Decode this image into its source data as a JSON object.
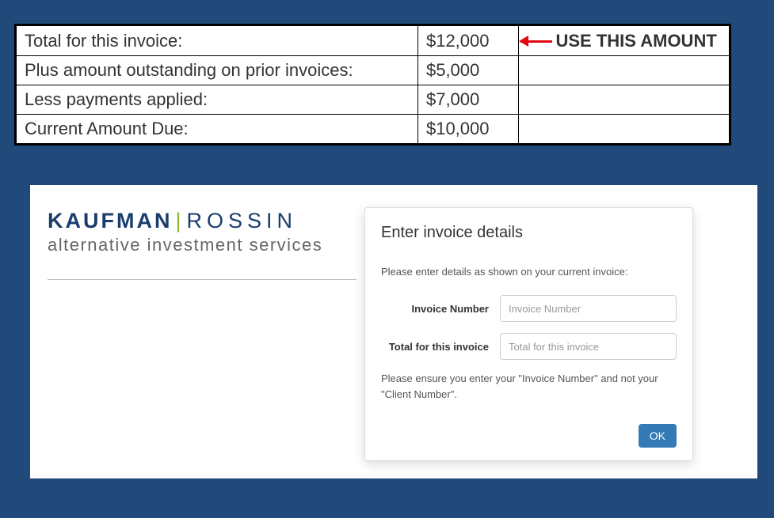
{
  "invoice_table": {
    "rows": [
      {
        "label": "Total for this invoice:",
        "amount": "$12,000",
        "note": "USE THIS AMOUNT"
      },
      {
        "label": "Plus amount outstanding on prior invoices:",
        "amount": "$5,000",
        "note": ""
      },
      {
        "label": "Less payments applied:",
        "amount": "$7,000",
        "note": ""
      },
      {
        "label": "Current Amount Due:",
        "amount": "$10,000",
        "note": ""
      }
    ]
  },
  "brand": {
    "kaufman": "KAUFMAN",
    "rossin": "ROSSIN",
    "tagline": "alternative investment services"
  },
  "dialog": {
    "title": "Enter invoice details",
    "intro": "Please enter details as shown on your current invoice:",
    "invoice_number_label": "Invoice Number",
    "invoice_number_placeholder": "Invoice Number",
    "total_label": "Total for this invoice",
    "total_placeholder": "Total for this invoice",
    "note": "Please ensure you enter your \"Invoice Number\" and not your \"Client Number\".",
    "ok": "OK"
  }
}
